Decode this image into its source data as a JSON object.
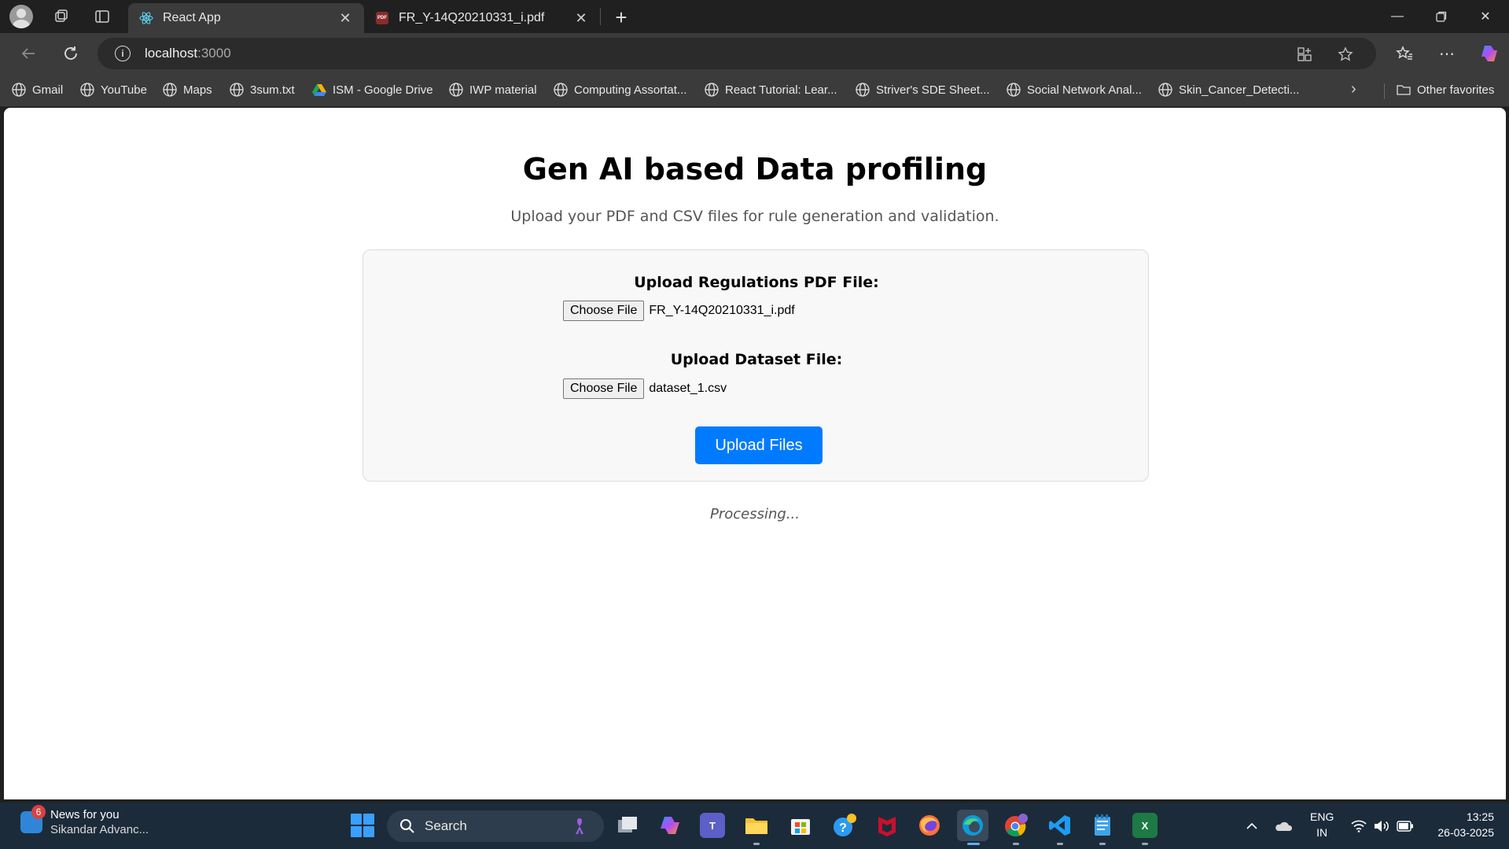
{
  "browser": {
    "tabs": [
      {
        "title": "React App",
        "active": true,
        "icon": "react-icon"
      },
      {
        "title": "FR_Y-14Q20210331_i.pdf",
        "active": false,
        "icon": "pdf-icon"
      }
    ],
    "address": {
      "host": "localhost",
      "port": ":3000"
    },
    "bookmarks": [
      "Gmail",
      "YouTube",
      "Maps",
      "3sum.txt",
      "ISM - Google Drive",
      "IWP material",
      "Computing Assortat...",
      "React Tutorial: Lear...",
      "Striver's SDE Sheet...",
      "Social Network Anal...",
      "Skin_Cancer_Detecti..."
    ],
    "other_favorites": "Other favorites"
  },
  "page": {
    "title": "Gen AI based Data profiling",
    "subtitle": "Upload your PDF and CSV files for rule generation and validation.",
    "pdf_label": "Upload Regulations PDF File:",
    "pdf_button": "Choose File",
    "pdf_file": "FR_Y-14Q20210331_i.pdf",
    "dataset_label": "Upload Dataset File:",
    "dataset_button": "Choose File",
    "dataset_file": "dataset_1.csv",
    "upload_button": "Upload Files",
    "status": "Processing..."
  },
  "taskbar": {
    "news_badge": "6",
    "news_title": "News for you",
    "news_sub": "Sikandar Advanc...",
    "search_label": "Search",
    "lang_top": "ENG",
    "lang_bottom": "IN",
    "time": "13:25",
    "date": "26-03-2025"
  },
  "colors": {
    "accent": "#007bff",
    "taskbar": "#1c2b3a",
    "chrome": "#3b3b3b"
  }
}
